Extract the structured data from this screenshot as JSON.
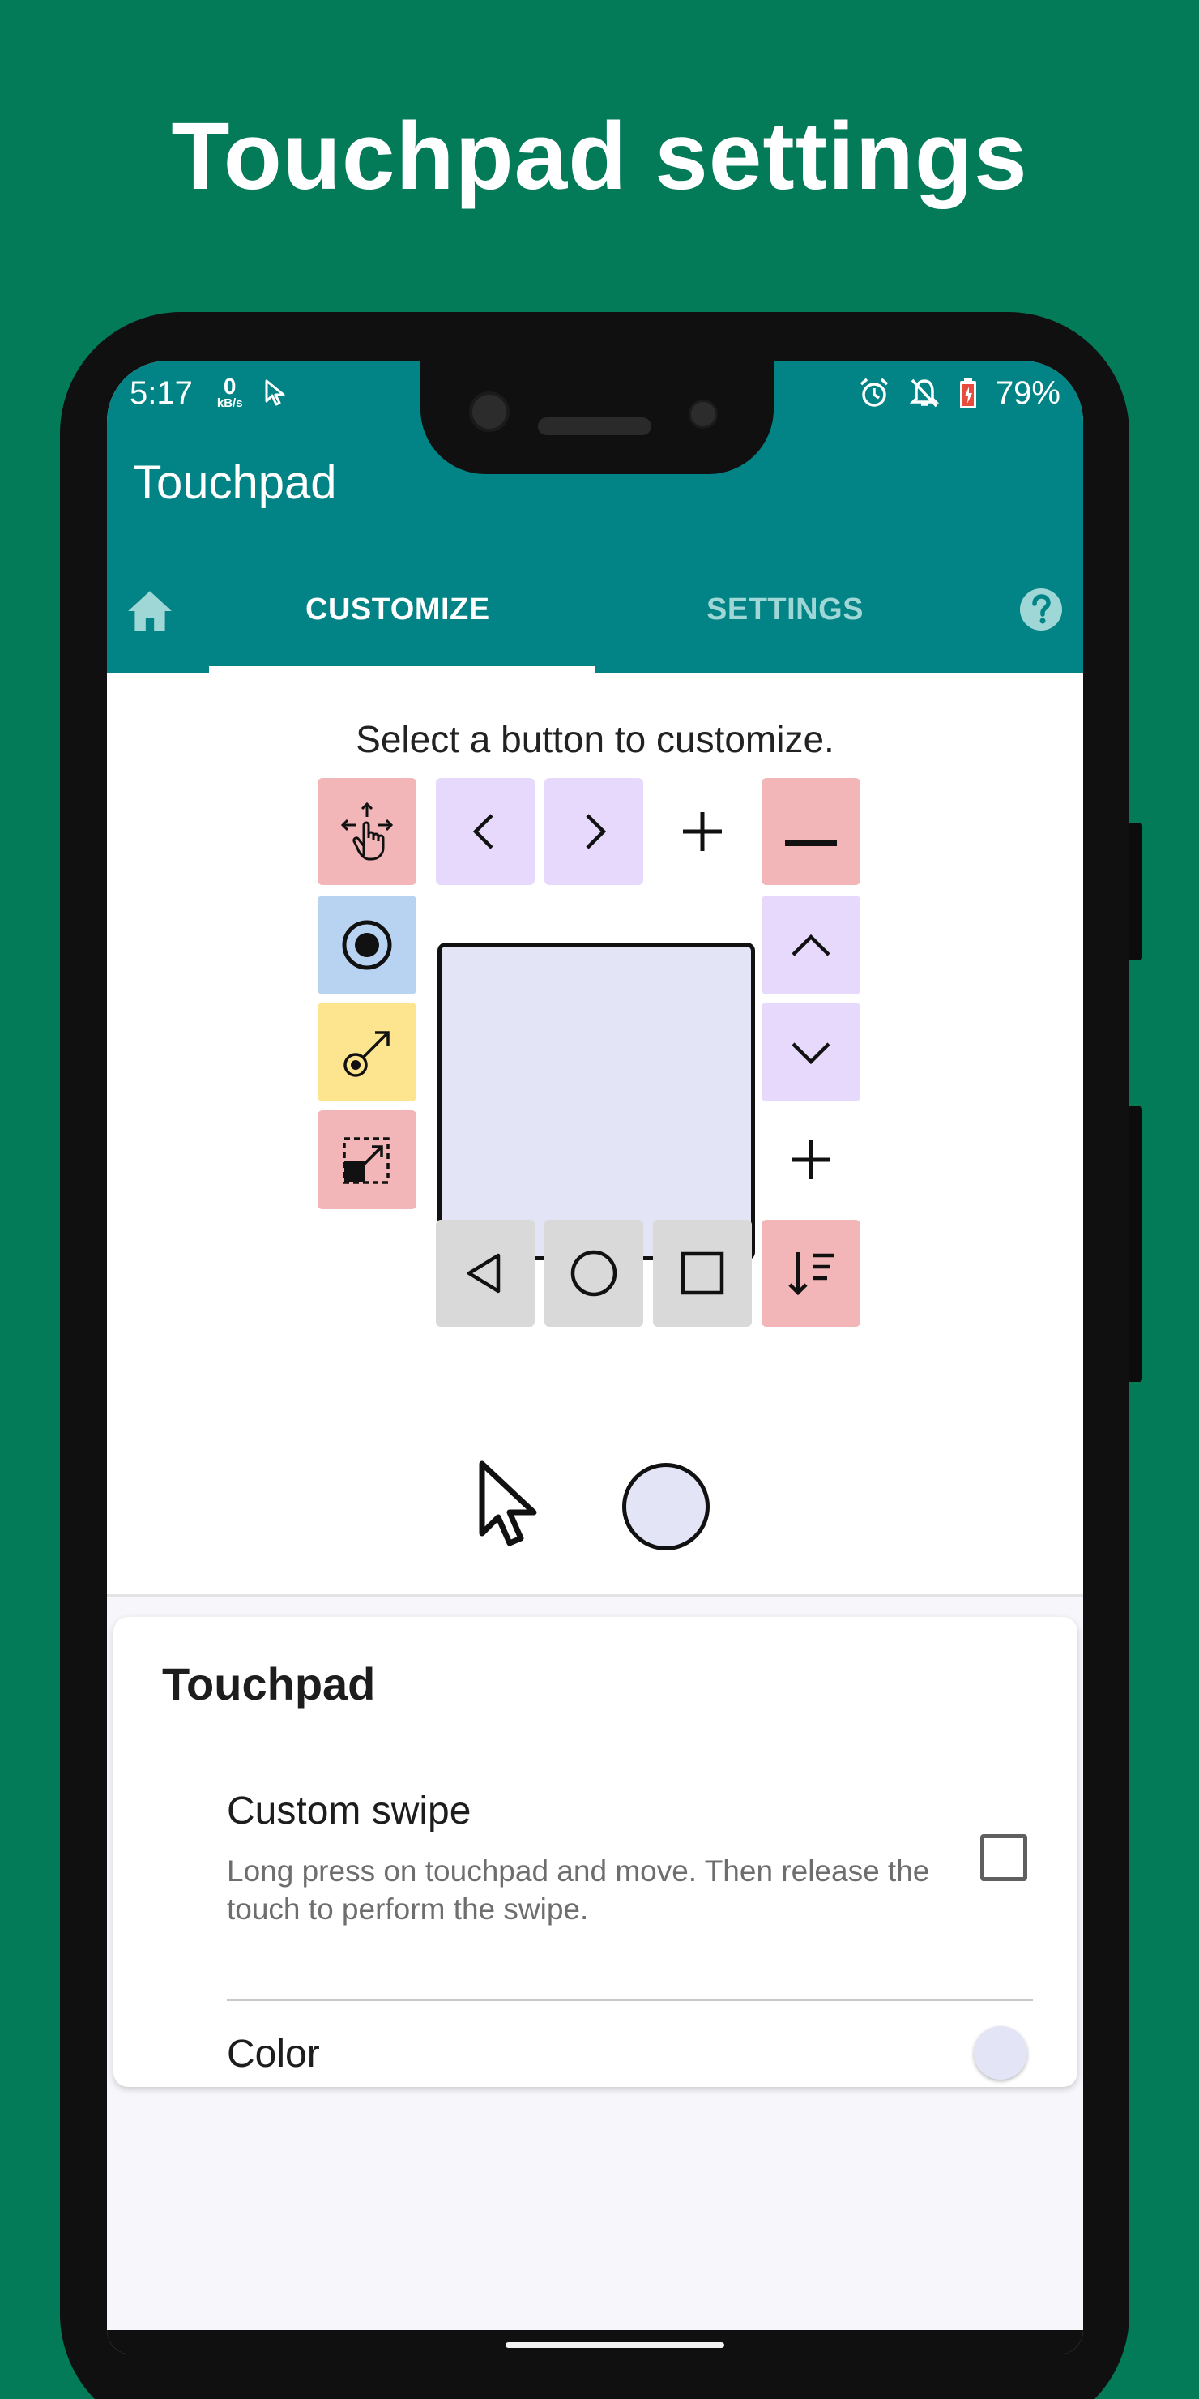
{
  "headline": "Touchpad settings",
  "status_bar": {
    "time": "5:17",
    "net_speed_value": "0",
    "net_speed_unit": "kB/s",
    "battery": "79%"
  },
  "app": {
    "title": "Touchpad",
    "tabs": [
      {
        "label": "CUSTOMIZE",
        "active": true
      },
      {
        "label": "SETTINGS",
        "active": false
      }
    ]
  },
  "customize": {
    "hint": "Select a button to customize."
  },
  "colors": {
    "primary": "#028486",
    "background": "#037a58",
    "pad_color": "#e3e4f6",
    "pink": "#f3b6b8",
    "lilac": "#e6d9fb",
    "blue": "#b7d3f1",
    "yellow": "#fde58f",
    "grey": "#d9d9d9"
  },
  "grid_buttons": {
    "top_row": [
      "drag-icon",
      "chevron-left-icon",
      "chevron-right-icon",
      "add-icon",
      "minus-icon"
    ],
    "left_column": [
      "radio-dot-icon",
      "pointer-move-icon",
      "select-area-icon"
    ],
    "right_column": [
      "chevron-up-icon",
      "chevron-down-icon",
      "add-icon"
    ],
    "bottom_row": [
      "add-icon",
      "back-triangle-icon",
      "home-circle-icon",
      "recents-square-icon",
      "sort-icon"
    ]
  },
  "settings_card": {
    "title": "Touchpad",
    "custom_swipe": {
      "title": "Custom swipe",
      "summary": "Long press on touchpad and move. Then release the touch to perform the swipe.",
      "checked": false
    },
    "color": {
      "title": "Color",
      "value": "#e3e4f6"
    }
  }
}
